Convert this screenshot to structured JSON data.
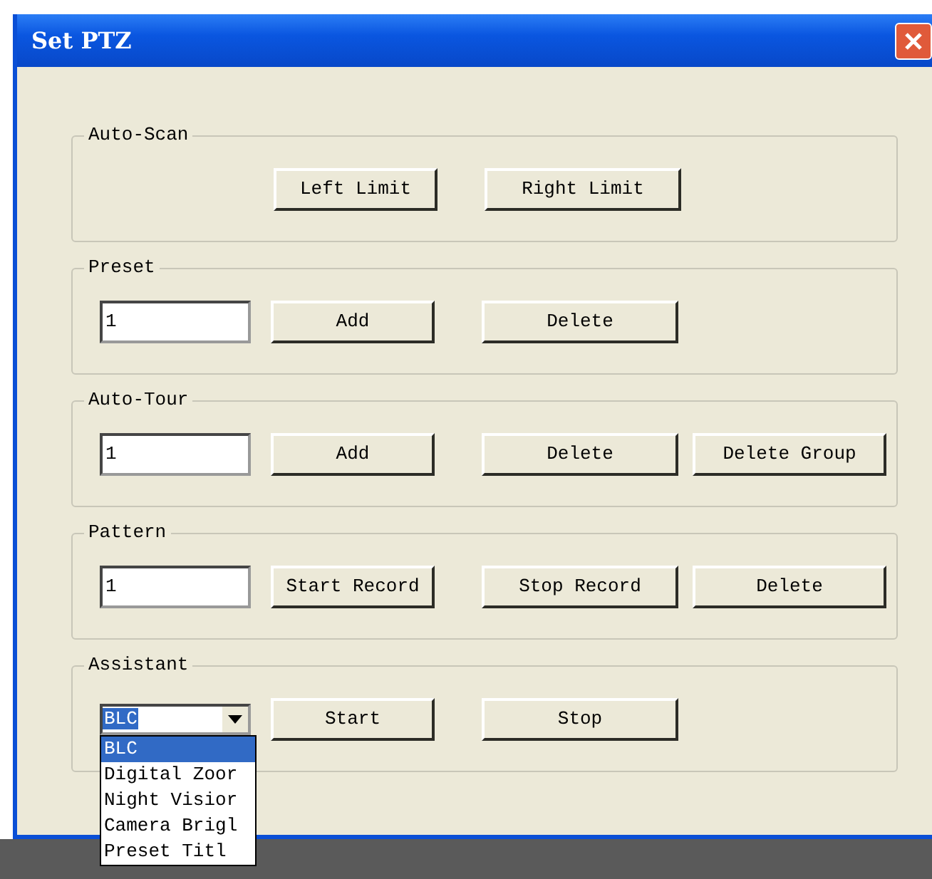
{
  "window": {
    "title": "Set PTZ"
  },
  "groups": [
    {
      "title": "Auto-Scan",
      "kind": "buttons",
      "buttons": [
        "Left Limit",
        "Right Limit"
      ]
    },
    {
      "title": "Preset",
      "kind": "field",
      "value": "1",
      "buttons": [
        "Add",
        "Delete"
      ]
    },
    {
      "title": "Auto-Tour",
      "kind": "field",
      "value": "1",
      "buttons": [
        "Add",
        "Delete",
        "Delete Group"
      ]
    },
    {
      "title": "Pattern",
      "kind": "field",
      "value": "1",
      "buttons": [
        "Start Record",
        "Stop Record",
        "Delete"
      ]
    },
    {
      "title": "Assistant",
      "kind": "select",
      "value": "BLC",
      "expanded": true,
      "options": [
        {
          "label": "BLC",
          "selected": true
        },
        {
          "label": "Digital Zoor",
          "selected": false
        },
        {
          "label": "Night Visior",
          "selected": false
        },
        {
          "label": "Camera Brigl",
          "selected": false
        },
        {
          "label": "Preset Titl",
          "selected": false
        }
      ],
      "buttons": [
        "Start",
        "Stop"
      ]
    }
  ]
}
